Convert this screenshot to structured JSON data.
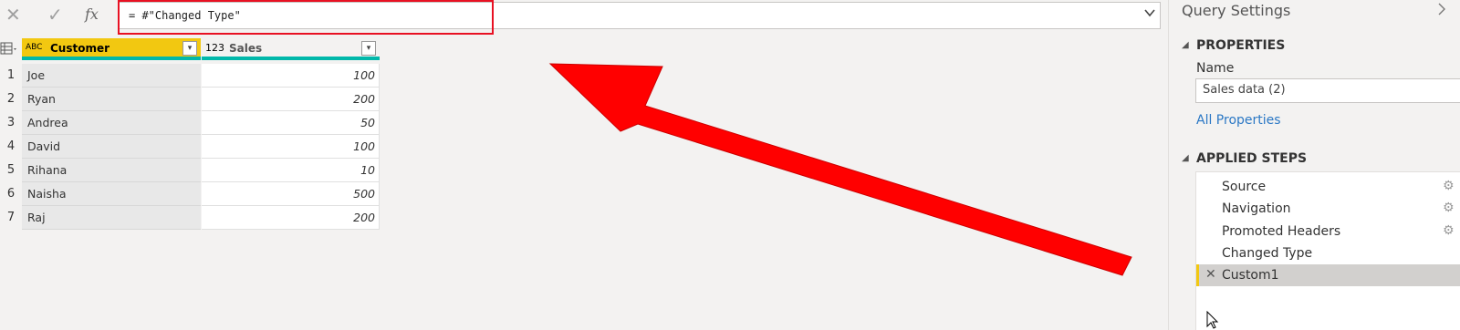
{
  "formula_bar": {
    "cancel_icon": "✕",
    "confirm_icon": "✓",
    "fx_label": "fx",
    "formula": "= #\"Changed Type\"",
    "chevron": "⌄"
  },
  "table": {
    "columns": [
      {
        "type_icon": "ABC",
        "name": "Customer"
      },
      {
        "type_icon": "123",
        "name": "Sales"
      }
    ],
    "rows": [
      {
        "n": "1",
        "customer": "Joe",
        "sales": "100"
      },
      {
        "n": "2",
        "customer": "Ryan",
        "sales": "200"
      },
      {
        "n": "3",
        "customer": "Andrea",
        "sales": "50"
      },
      {
        "n": "4",
        "customer": "David",
        "sales": "100"
      },
      {
        "n": "5",
        "customer": "Rihana",
        "sales": "10"
      },
      {
        "n": "6",
        "customer": "Naisha",
        "sales": "500"
      },
      {
        "n": "7",
        "customer": "Raj",
        "sales": "200"
      }
    ]
  },
  "settings": {
    "title": "Query Settings",
    "properties_heading": "PROPERTIES",
    "name_label": "Name",
    "name_value": "Sales data (2)",
    "all_properties": "All Properties",
    "steps_heading": "APPLIED STEPS",
    "steps": [
      {
        "label": "Source",
        "gear": true,
        "selected": false
      },
      {
        "label": "Navigation",
        "gear": true,
        "selected": false
      },
      {
        "label": "Promoted Headers",
        "gear": true,
        "selected": false
      },
      {
        "label": "Changed Type",
        "gear": false,
        "selected": false
      },
      {
        "label": "Custom1",
        "gear": false,
        "selected": true
      }
    ]
  },
  "colors": {
    "accent_header": "#f2c811",
    "teal_bar": "#01b8aa",
    "annotation_red": "#ff0000",
    "link_blue": "#2b78c5"
  }
}
